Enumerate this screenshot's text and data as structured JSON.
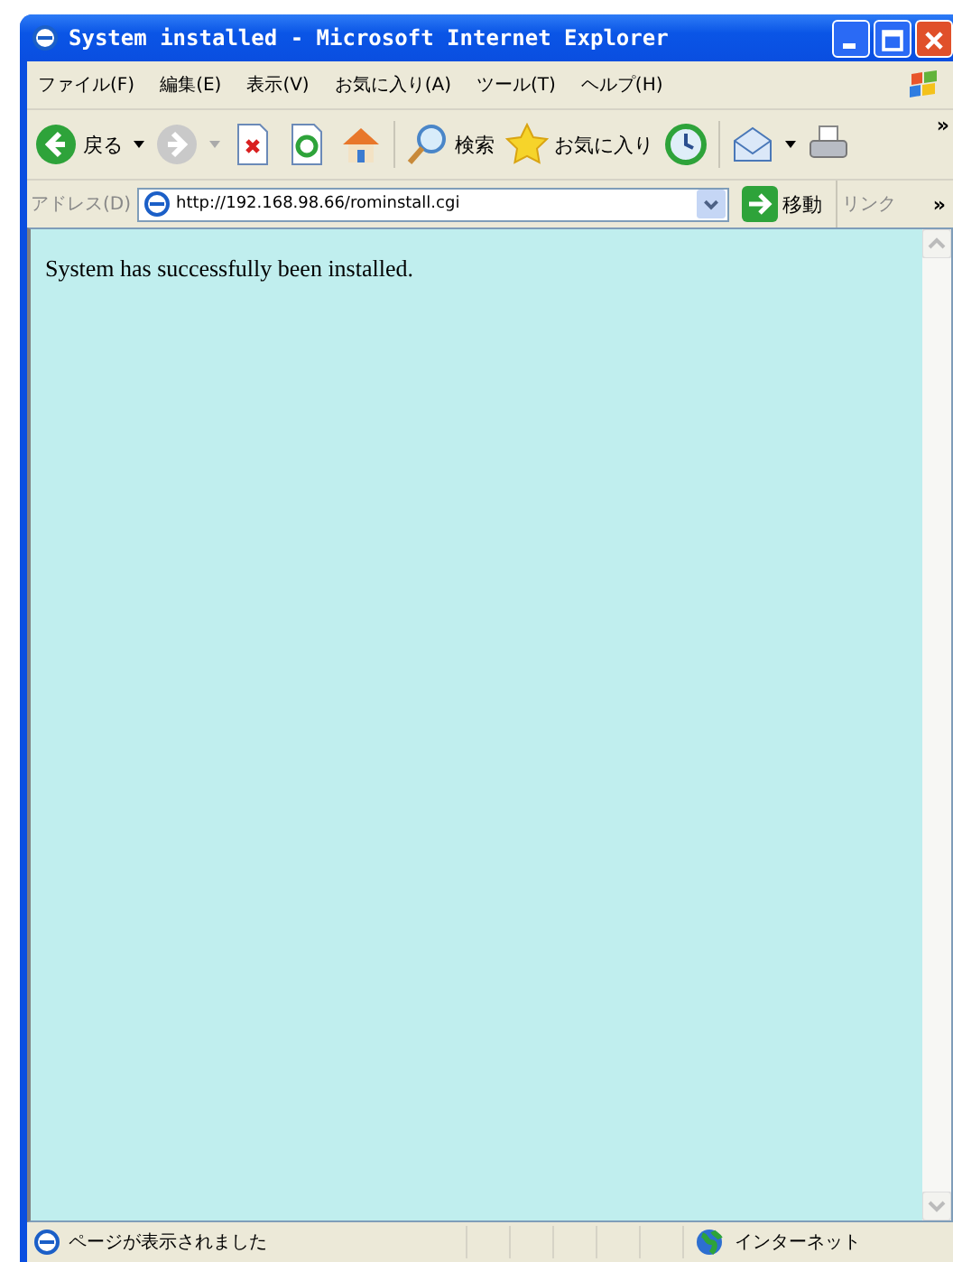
{
  "window": {
    "title": "System installed - Microsoft Internet Explorer"
  },
  "menu": [
    "ファイル(F)",
    "編集(E)",
    "表示(V)",
    "お気に入り(A)",
    "ツール(T)",
    "ヘルプ(H)"
  ],
  "toolbar": {
    "back": "戻る",
    "search": "検索",
    "favorites": "お気に入り",
    "more": "»"
  },
  "address_bar": {
    "label": "アドレス(D)",
    "url": "http://192.168.98.66/rominstall.cgi",
    "go": "移動",
    "links": "リンク",
    "more": "»"
  },
  "page": {
    "text": "System has successfully been installed."
  },
  "status_bar": {
    "text": "ページが表示されました",
    "zone": "インターネット"
  }
}
